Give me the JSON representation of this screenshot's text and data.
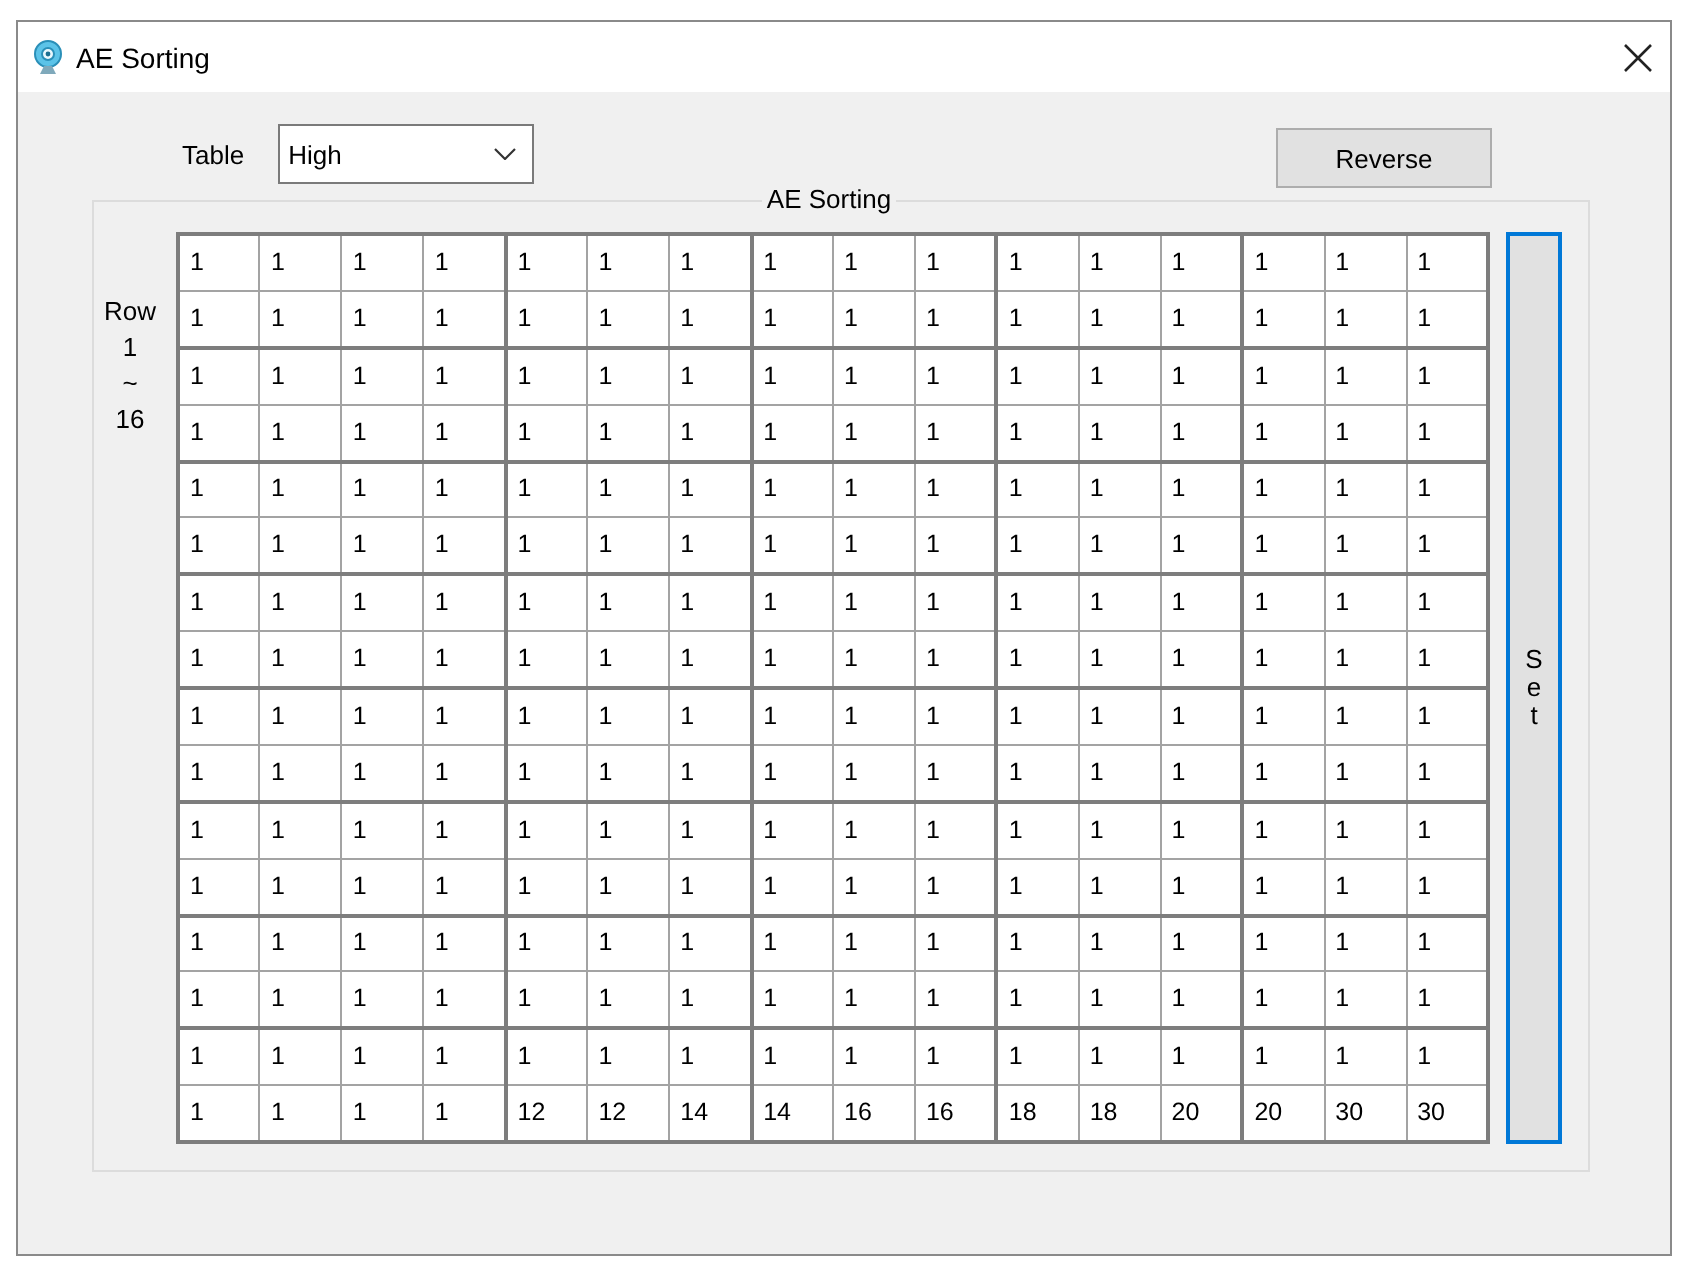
{
  "window": {
    "title": "AE Sorting"
  },
  "controls": {
    "table_label": "Table",
    "table_select": {
      "value": "High"
    },
    "reverse_button": "Reverse"
  },
  "group": {
    "title": "AE Sorting",
    "row_label": "Row\n1\n~\n16",
    "grid": {
      "rows": [
        [
          "1",
          "1",
          "1",
          "1",
          "1",
          "1",
          "1",
          "1",
          "1",
          "1",
          "1",
          "1",
          "1",
          "1",
          "1",
          "1"
        ],
        [
          "1",
          "1",
          "1",
          "1",
          "1",
          "1",
          "1",
          "1",
          "1",
          "1",
          "1",
          "1",
          "1",
          "1",
          "1",
          "1"
        ],
        [
          "1",
          "1",
          "1",
          "1",
          "1",
          "1",
          "1",
          "1",
          "1",
          "1",
          "1",
          "1",
          "1",
          "1",
          "1",
          "1"
        ],
        [
          "1",
          "1",
          "1",
          "1",
          "1",
          "1",
          "1",
          "1",
          "1",
          "1",
          "1",
          "1",
          "1",
          "1",
          "1",
          "1"
        ],
        [
          "1",
          "1",
          "1",
          "1",
          "1",
          "1",
          "1",
          "1",
          "1",
          "1",
          "1",
          "1",
          "1",
          "1",
          "1",
          "1"
        ],
        [
          "1",
          "1",
          "1",
          "1",
          "1",
          "1",
          "1",
          "1",
          "1",
          "1",
          "1",
          "1",
          "1",
          "1",
          "1",
          "1"
        ],
        [
          "1",
          "1",
          "1",
          "1",
          "1",
          "1",
          "1",
          "1",
          "1",
          "1",
          "1",
          "1",
          "1",
          "1",
          "1",
          "1"
        ],
        [
          "1",
          "1",
          "1",
          "1",
          "1",
          "1",
          "1",
          "1",
          "1",
          "1",
          "1",
          "1",
          "1",
          "1",
          "1",
          "1"
        ],
        [
          "1",
          "1",
          "1",
          "1",
          "1",
          "1",
          "1",
          "1",
          "1",
          "1",
          "1",
          "1",
          "1",
          "1",
          "1",
          "1"
        ],
        [
          "1",
          "1",
          "1",
          "1",
          "1",
          "1",
          "1",
          "1",
          "1",
          "1",
          "1",
          "1",
          "1",
          "1",
          "1",
          "1"
        ],
        [
          "1",
          "1",
          "1",
          "1",
          "1",
          "1",
          "1",
          "1",
          "1",
          "1",
          "1",
          "1",
          "1",
          "1",
          "1",
          "1"
        ],
        [
          "1",
          "1",
          "1",
          "1",
          "1",
          "1",
          "1",
          "1",
          "1",
          "1",
          "1",
          "1",
          "1",
          "1",
          "1",
          "1"
        ],
        [
          "1",
          "1",
          "1",
          "1",
          "1",
          "1",
          "1",
          "1",
          "1",
          "1",
          "1",
          "1",
          "1",
          "1",
          "1",
          "1"
        ],
        [
          "1",
          "1",
          "1",
          "1",
          "1",
          "1",
          "1",
          "1",
          "1",
          "1",
          "1",
          "1",
          "1",
          "1",
          "1",
          "1"
        ],
        [
          "1",
          "1",
          "1",
          "1",
          "1",
          "1",
          "1",
          "1",
          "1",
          "1",
          "1",
          "1",
          "1",
          "1",
          "1",
          "1"
        ],
        [
          "1",
          "1",
          "1",
          "1",
          "12",
          "12",
          "14",
          "14",
          "16",
          "16",
          "18",
          "18",
          "20",
          "20",
          "30",
          "30"
        ]
      ]
    },
    "set_button": {
      "label": "Set",
      "focused": true
    }
  }
}
